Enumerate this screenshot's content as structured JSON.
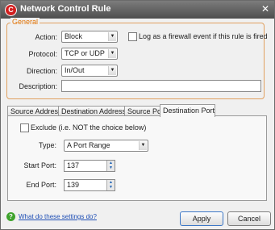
{
  "window": {
    "title": "Network Control Rule",
    "app_icon_letter": "C"
  },
  "general": {
    "legend": "General",
    "action_label": "Action:",
    "action_value": "Block",
    "log_label": "Log as a firewall event if this rule is fired",
    "protocol_label": "Protocol:",
    "protocol_value": "TCP or UDP",
    "direction_label": "Direction:",
    "direction_value": "In/Out",
    "description_label": "Description:",
    "description_value": ""
  },
  "tabs": [
    {
      "label": "Source Address"
    },
    {
      "label": "Destination Address"
    },
    {
      "label": "Source Port"
    },
    {
      "label": "Destination Port"
    }
  ],
  "dest_port": {
    "exclude_label": "Exclude (i.e. NOT the choice below)",
    "type_label": "Type:",
    "type_value": "A Port Range",
    "start_label": "Start Port:",
    "start_value": "137",
    "end_label": "End Port:",
    "end_value": "139"
  },
  "footer": {
    "help_link": "What do these settings do?",
    "apply": "Apply",
    "cancel": "Cancel"
  }
}
